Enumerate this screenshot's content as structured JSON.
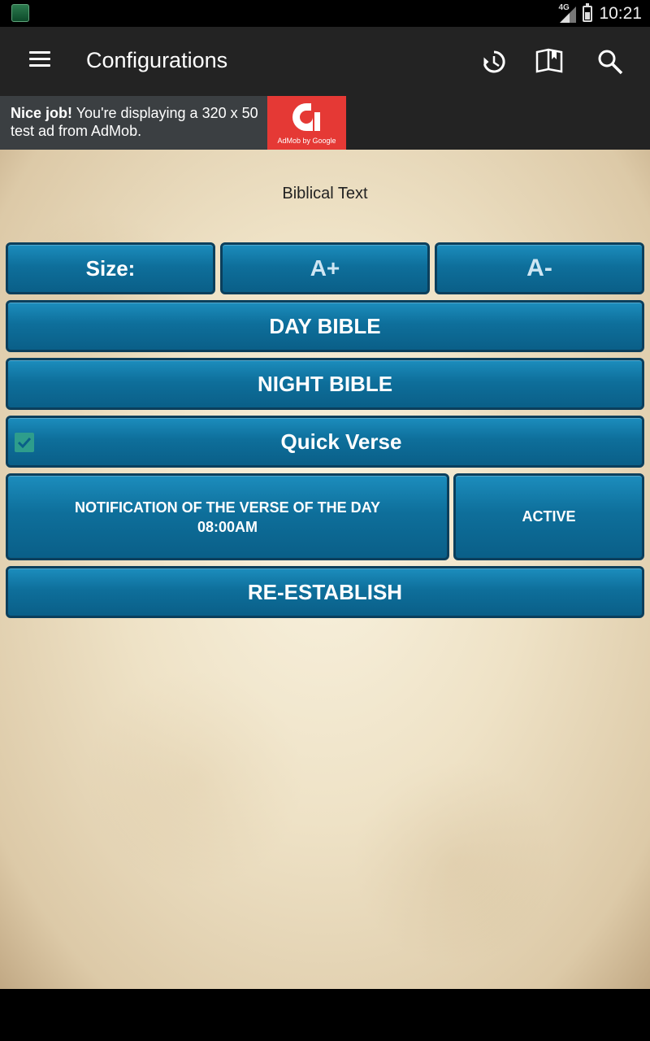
{
  "status_bar": {
    "network": "4G",
    "time": "10:21"
  },
  "app_bar": {
    "title": "Configurations",
    "icons": [
      "menu-icon",
      "history-icon",
      "book-icon",
      "search-icon"
    ]
  },
  "ad": {
    "bold": "Nice job!",
    "text": " You're displaying a 320 x 50 test ad from AdMob.",
    "logo_caption": "AdMob by Google",
    "brand_color": "#e53935"
  },
  "content": {
    "heading": "Biblical Text",
    "size_label": "Size:",
    "increase_label": "A+",
    "decrease_label": "A-",
    "day_label": "DAY BIBLE",
    "night_label": "NIGHT BIBLE",
    "quick_verse_label": "Quick Verse",
    "quick_verse_checked": true,
    "notification_line1": "NOTIFICATION OF THE VERSE OF THE DAY",
    "notification_time": "08:00AM",
    "active_label": "ACTIVE",
    "reestablish_label": "RE-ESTABLISH"
  },
  "colors": {
    "button": "#0e6f9b",
    "button_border": "#0b3f5c",
    "app_bar": "#232323",
    "checkbox": "#2e9d8c"
  }
}
